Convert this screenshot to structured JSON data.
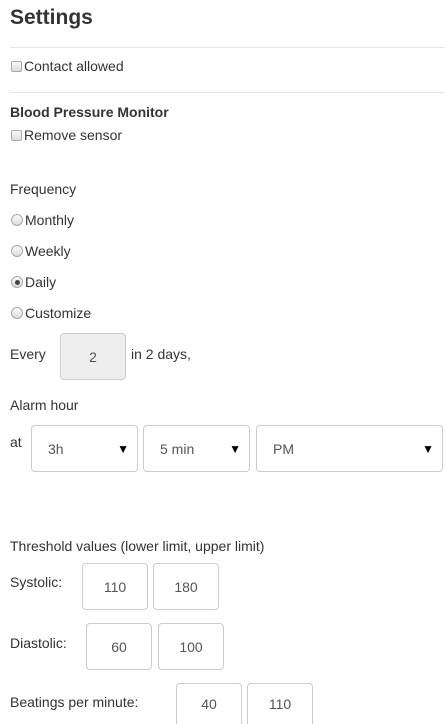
{
  "title": "Settings",
  "contact": {
    "label": "Contact allowed",
    "checked": false
  },
  "device": {
    "heading": "Blood Pressure Monitor",
    "remove_label": "Remove sensor",
    "remove_checked": false
  },
  "frequency": {
    "label": "Frequency",
    "options": [
      {
        "label": "Monthly",
        "checked": false
      },
      {
        "label": "Weekly",
        "checked": false
      },
      {
        "label": "Daily",
        "checked": true
      },
      {
        "label": "Customize",
        "checked": false
      }
    ],
    "every_prefix": "Every",
    "every_value": "2",
    "every_suffix": "in 2 days,"
  },
  "alarm": {
    "label": "Alarm hour",
    "at_label": "at",
    "hour": "3h",
    "minute": "5 min",
    "ampm": "PM",
    "caret": "▼"
  },
  "threshold": {
    "heading": "Threshold values (lower limit, upper limit)",
    "systolic": {
      "label": "Systolic:",
      "lower": "110",
      "upper": "180"
    },
    "diastolic": {
      "label": "Diastolic:",
      "lower": "60",
      "upper": "100"
    },
    "bpm": {
      "label": "Beatings per minute:",
      "lower": "40",
      "upper": "110"
    }
  }
}
